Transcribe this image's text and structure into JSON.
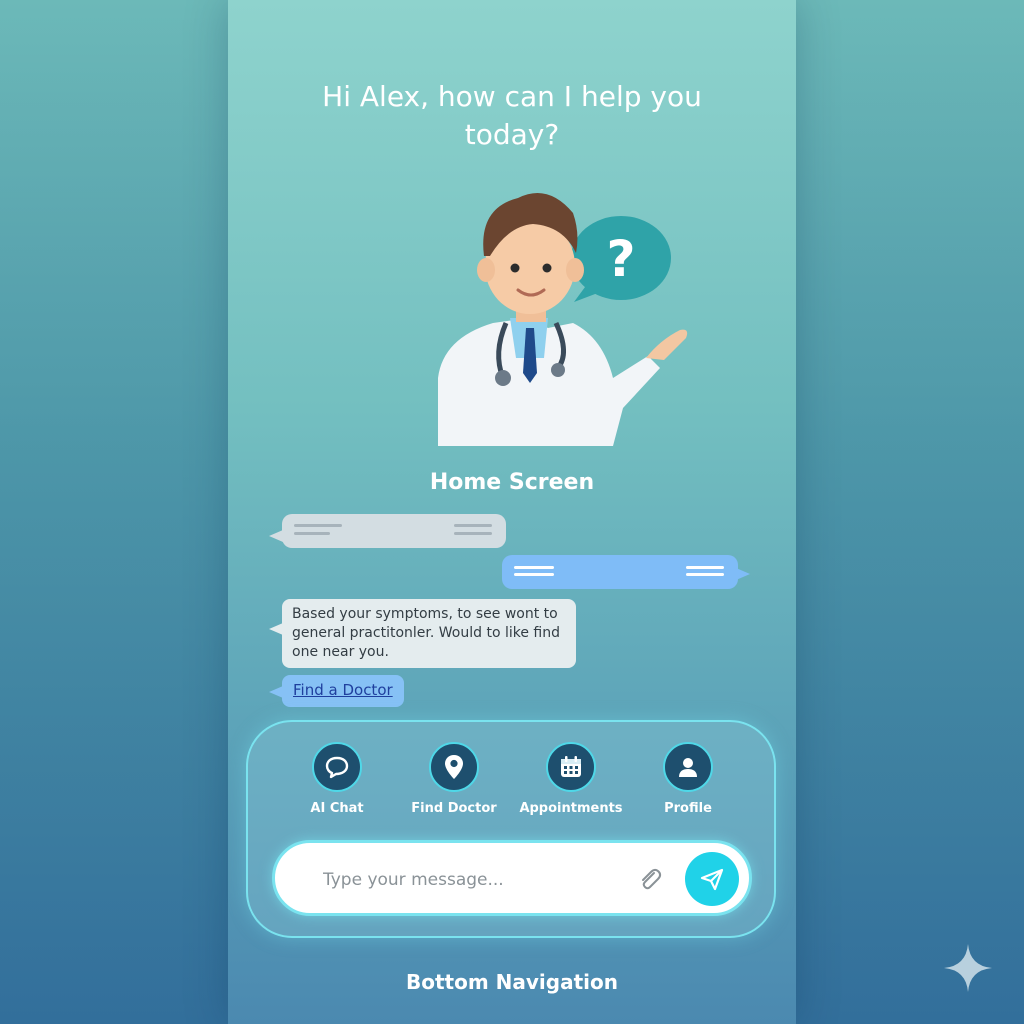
{
  "greeting": "Hi Alex, how can I help you today?",
  "screen_label": "Home Screen",
  "chat": {
    "ai_message": "Based your symptoms, to see wont to general practitonler. Would to like find one near you.",
    "link_label": "Find a Doctor"
  },
  "nav": {
    "items": [
      {
        "label": "AI Chat",
        "icon": "chat-bubble-icon"
      },
      {
        "label": "Find Doctor",
        "icon": "location-pin-icon"
      },
      {
        "label": "Appointments",
        "icon": "calendar-icon"
      },
      {
        "label": "Profile",
        "icon": "user-icon"
      }
    ]
  },
  "input": {
    "placeholder": "Type your message..."
  },
  "bottom_label": "Bottom Navigation",
  "colors": {
    "accent": "#20d2e8",
    "nav_circle": "#1e4f6e",
    "user_bubble": "#7fbcf7",
    "ai_bubble": "#e4ecee"
  }
}
